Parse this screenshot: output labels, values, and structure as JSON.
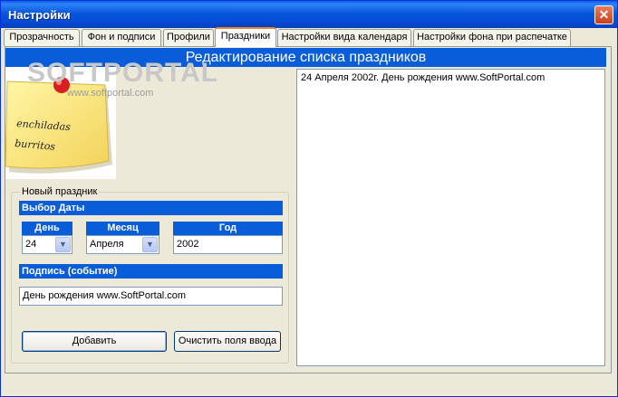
{
  "window": {
    "title": "Настройки",
    "close_glyph": "✕"
  },
  "tabs": [
    {
      "label": "Прозрачность"
    },
    {
      "label": "Фон и подписи"
    },
    {
      "label": "Профили"
    },
    {
      "label": "Праздники",
      "active": true
    },
    {
      "label": "Настройки вида календаря"
    },
    {
      "label": "Настройки фона при распечатке"
    }
  ],
  "header": {
    "title": "Редактирование списка праздников"
  },
  "logo": {
    "watermark_text": "SOFTPORTAL",
    "watermark_url": "www.softportal.com",
    "note_lines": [
      "enchiladas",
      "burritos"
    ]
  },
  "holiday_list": {
    "items": [
      "24 Апреля 2002г. День рождения www.SoftPortal.com"
    ]
  },
  "new_holiday": {
    "group_label": "Новый праздник",
    "date_section": "Выбор Даты",
    "day_label": "День",
    "day_value": "24",
    "month_label": "Месяц",
    "month_value": "Апреля",
    "year_label": "Год",
    "year_value": "2002",
    "caption_section": "Подпись (событие)",
    "caption_value": "День рождения www.SoftPortal.com",
    "add_button": "Добавить",
    "clear_button": "Очистить поля ввода"
  },
  "colors": {
    "title_bar": "#0a5fe8",
    "section_blue": "#0a5dd8",
    "panel_bg": "#ece9d8",
    "tab_active_accent": "#e68b2c"
  },
  "icons": {
    "combo_arrow": "chevron-down-icon",
    "close": "close-icon",
    "pushpin": "pushpin-icon"
  }
}
